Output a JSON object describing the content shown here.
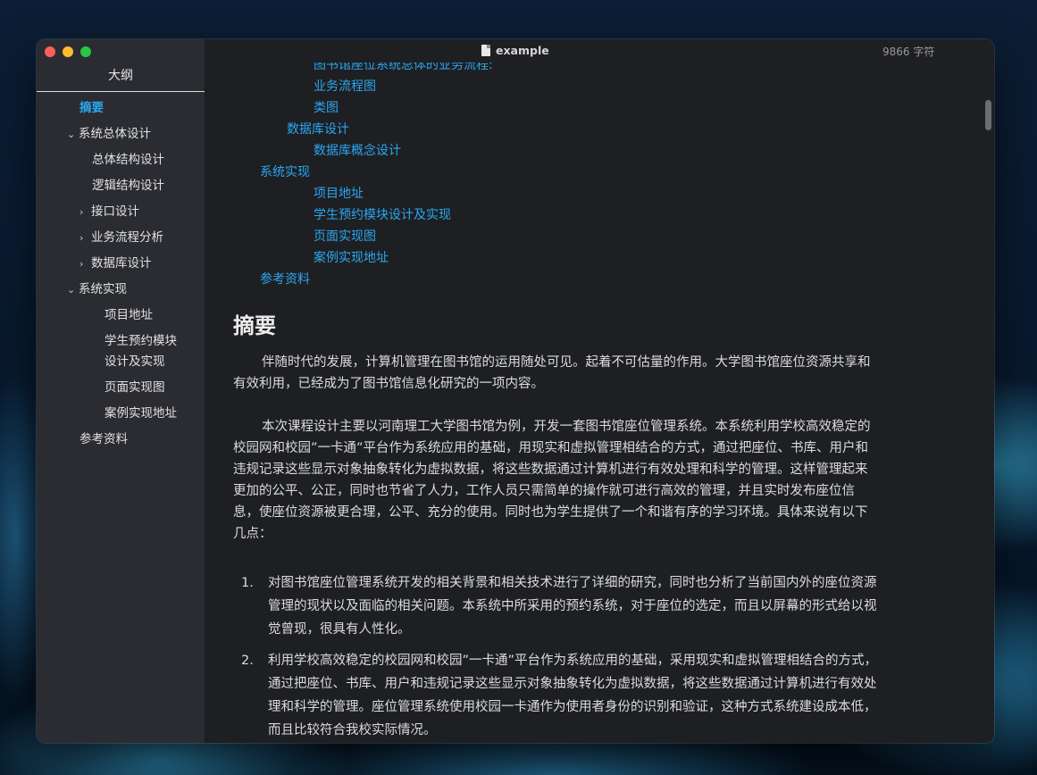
{
  "window": {
    "doc_title": "example",
    "char_count": "9866 字符"
  },
  "sidebar": {
    "title": "大纲",
    "items": [
      {
        "label": "摘要",
        "active": true,
        "chevron": ""
      },
      {
        "label": "系统总体设计",
        "chevron": "⌄"
      },
      {
        "label": "总体结构设计",
        "chevron": ""
      },
      {
        "label": "逻辑结构设计",
        "chevron": ""
      },
      {
        "label": "接口设计",
        "chevron": "›"
      },
      {
        "label": "业务流程分析",
        "chevron": "›"
      },
      {
        "label": "数据库设计",
        "chevron": "›"
      },
      {
        "label": "系统实现",
        "chevron": "⌄"
      },
      {
        "label": "项目地址",
        "chevron": ""
      },
      {
        "label": "学生预约模块",
        "chevron": ""
      },
      {
        "label": "设计及实现",
        "chevron": ""
      },
      {
        "label": "页面实现图",
        "chevron": ""
      },
      {
        "label": "案例实现地址",
        "chevron": ""
      },
      {
        "label": "参考资料",
        "chevron": ""
      }
    ]
  },
  "toc": [
    "图书馆座位系统总体的业务流程:",
    "业务流程图",
    "类图",
    "数据库设计",
    "数据库概念设计",
    "系统实现",
    "项目地址",
    "学生预约模块设计及实现",
    "页面实现图",
    "案例实现地址",
    "参考资料"
  ],
  "article": {
    "heading": "摘要",
    "para1_lines": [
      "伴随时代的发展，计算机管理在图书馆的运用随处可见。起着不可估量的作用。大学图书馆座位资源共享和",
      "有效利用，已经成为了图书馆信息化研究的一项内容。"
    ],
    "para2_lines": [
      "本次课程设计主要以河南理工大学图书馆为例，开发一套图书馆座位管理系统。本系统利用学校高效稳定的",
      "校园网和校园”一卡通”平台作为系统应用的基础，用现实和虚拟管理相结合的方式，通过把座位、书库、用户和",
      "违规记录这些显示对象抽象转化为虚拟数据，将这些数据通过计算机进行有效处理和科学的管理。这样管理起来",
      "更加的公平、公正，同时也节省了人力，工作人员只需简单的操作就可进行高效的管理，并且实时发布座位信",
      "息，使座位资源被更合理，公平、充分的使用。同时也为学生提供了一个和谐有序的学习环境。具体来说有以下",
      "几点："
    ],
    "list": [
      {
        "num": "1.",
        "lines": [
          "对图书馆座位管理系统开发的相关背景和相关技术进行了详细的研究，同时也分析了当前国内外的座位资源",
          "管理的现状以及面临的相关问题。本系统中所采用的预约系统，对于座位的选定，而且以屏幕的形式给以视",
          "觉曾现，很具有人性化。"
        ]
      },
      {
        "num": "2.",
        "lines": [
          "利用学校高效稳定的校园网和校园”一卡通”平台作为系统应用的基础，采用现实和虚拟管理相结合的方式，",
          "通过把座位、书库、用户和违规记录这些显示对象抽象转化为虚拟数据，将这些数据通过计算机进行有效处",
          "理和科学的管理。座位管理系统使用校园一卡通作为使用者身份的识别和验证，这种方式系统建设成本低，",
          "而且比较符合我校实际情况。"
        ]
      }
    ]
  }
}
